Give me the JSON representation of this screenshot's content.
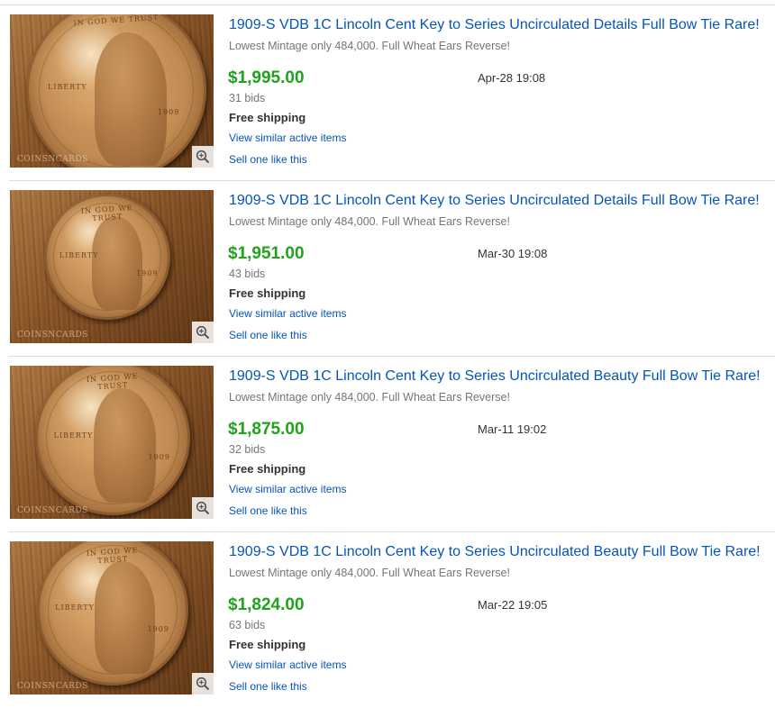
{
  "listings": [
    {
      "title": "1909-S VDB 1C Lincoln Cent Key to Series Uncirculated Details Full Bow Tie Rare!",
      "subtitle": "Lowest Mintage only 484,000. Full Wheat Ears Reverse!",
      "price": "$1,995.00",
      "date": "Apr-28 19:08",
      "bids": "31 bids",
      "shipping": "Free shipping",
      "similar_link": "View similar active items",
      "sell_link": "Sell one like this",
      "image_watermark": "COINSNCARDS",
      "coin_motto": "IN GOD WE TRUST",
      "coin_liberty": "LIBERTY",
      "coin_year": "1909"
    },
    {
      "title": "1909-S VDB 1C Lincoln Cent Key to Series Uncirculated Details Full Bow Tie Rare!",
      "subtitle": "Lowest Mintage only 484,000. Full Wheat Ears Reverse!",
      "price": "$1,951.00",
      "date": "Mar-30 19:08",
      "bids": "43 bids",
      "shipping": "Free shipping",
      "similar_link": "View similar active items",
      "sell_link": "Sell one like this",
      "image_watermark": "COINSNCARDS",
      "coin_motto": "IN GOD WE TRUST",
      "coin_liberty": "LIBERTY",
      "coin_year": "1909"
    },
    {
      "title": "1909-S VDB 1C Lincoln Cent Key to Series Uncirculated Beauty Full Bow Tie Rare!",
      "subtitle": "Lowest Mintage only 484,000. Full Wheat Ears Reverse!",
      "price": "$1,875.00",
      "date": "Mar-11 19:02",
      "bids": "32 bids",
      "shipping": "Free shipping",
      "similar_link": "View similar active items",
      "sell_link": "Sell one like this",
      "image_watermark": "COINSNCARDS",
      "coin_motto": "IN GOD WE TRUST",
      "coin_liberty": "LIBERTY",
      "coin_year": "1909"
    },
    {
      "title": "1909-S VDB 1C Lincoln Cent Key to Series Uncirculated Beauty Full Bow Tie Rare!",
      "subtitle": "Lowest Mintage only 484,000. Full Wheat Ears Reverse!",
      "price": "$1,824.00",
      "date": "Mar-22 19:05",
      "bids": "63 bids",
      "shipping": "Free shipping",
      "similar_link": "View similar active items",
      "sell_link": "Sell one like this",
      "image_watermark": "COINSNCARDS",
      "coin_motto": "IN GOD WE TRUST",
      "coin_liberty": "LIBERTY",
      "coin_year": "1909"
    }
  ],
  "colors": {
    "link": "#0654ba",
    "price": "#1fa31a",
    "muted": "#767676",
    "divider": "#dddddd"
  },
  "icons": {
    "zoom": "zoom-in-icon"
  }
}
